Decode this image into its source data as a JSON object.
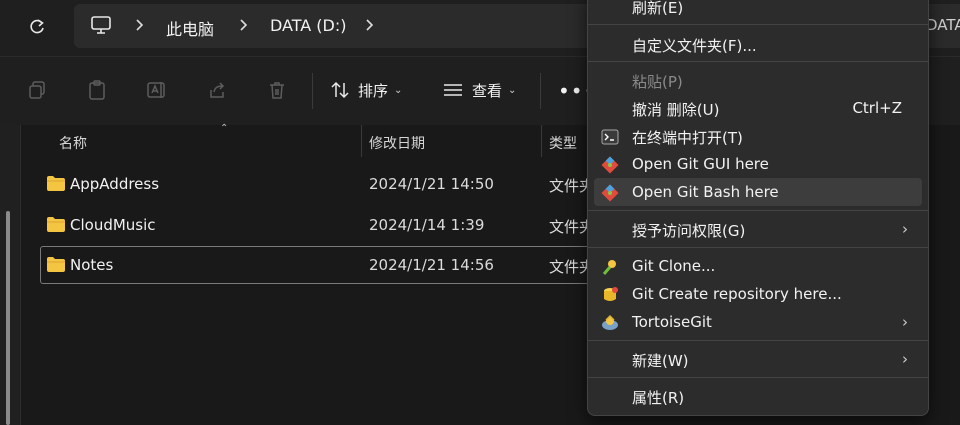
{
  "address": {
    "crumbs": [
      "此电脑",
      "DATA (D:)"
    ],
    "overflow_text": "DATA"
  },
  "toolbar": {
    "sort_label": "排序",
    "view_label": "查看",
    "more_label": "•••"
  },
  "columns": {
    "name": "名称",
    "modified": "修改日期",
    "type": "类型"
  },
  "files": [
    {
      "name": "AppAddress",
      "modified": "2024/1/21 14:50",
      "type": "文件夹"
    },
    {
      "name": "CloudMusic",
      "modified": "2024/1/14 1:39",
      "type": "文件夹"
    },
    {
      "name": "Notes",
      "modified": "2024/1/21 14:56",
      "type": "文件夹",
      "selected": true
    }
  ],
  "context_menu": {
    "items": [
      {
        "label": "刷新(E)"
      },
      {
        "label": "自定义文件夹(F)..."
      },
      {
        "label": "粘贴(P)",
        "disabled": true
      },
      {
        "label": "撤消 删除(U)",
        "shortcut": "Ctrl+Z"
      },
      {
        "label": "在终端中打开(T)",
        "icon": "terminal-icon"
      },
      {
        "label": "Open Git GUI here",
        "icon": "git-gui-icon"
      },
      {
        "label": "Open Git Bash here",
        "icon": "git-bash-icon",
        "hover": true
      },
      {
        "label": "授予访问权限(G)",
        "submenu": true
      },
      {
        "label": "Git Clone...",
        "icon": "git-clone-icon"
      },
      {
        "label": "Git Create repository here...",
        "icon": "git-create-repo-icon"
      },
      {
        "label": "TortoiseGit",
        "icon": "tortoisegit-icon",
        "submenu": true
      },
      {
        "label": "新建(W)",
        "submenu": true
      },
      {
        "label": "属性(R)"
      }
    ]
  },
  "colors": {
    "background": "#1c1c1c",
    "menu_background": "#2c2c2c",
    "folder_yellow": "#f4c542",
    "hover": "#3d3d3d"
  }
}
